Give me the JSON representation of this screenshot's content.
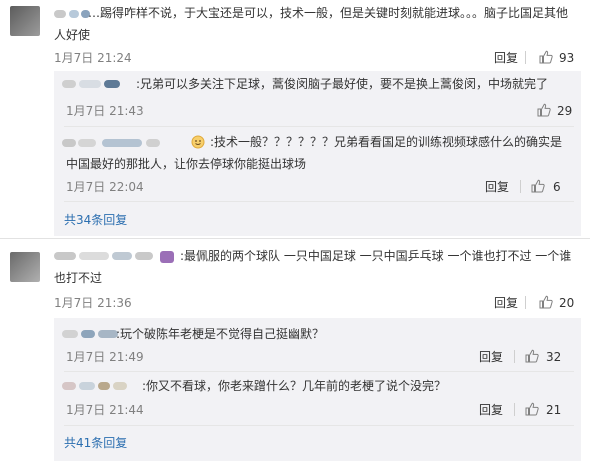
{
  "comments": [
    {
      "text": "…踢得咋样不说，于大宝还是可以，技术一般，但是关键时刻就能进球。。。脑子比国足其他人好使",
      "time": "1月7日 21:24",
      "reply_label": "回复",
      "likes": "93",
      "replies": [
        {
          "text": ":兄弟可以多关注下足球，蒿俊闵脑子最好使，要不是换上蒿俊闵，中场就完了",
          "time": "1月7日 21:43",
          "likes": "29"
        },
        {
          "text": ":技术一般？？？？？？兄弟看看国足的训练视频球感什么的确实是中国最好的那批人，让你去停球你能挺出球场",
          "time": "1月7日 22:04",
          "likes": "6",
          "reply_label": "回复"
        }
      ],
      "more_label": "共34条回复"
    },
    {
      "text": ":最佩服的两个球队  一只中国足球 一只中国乒乓球  一个谁也打不过 一个谁也打不过",
      "time": "1月7日 21:36",
      "reply_label": "回复",
      "likes": "20",
      "replies": [
        {
          "text": ":玩个破陈年老梗是不觉得自己挺幽默？",
          "time": "1月7日 21:49",
          "likes": "32",
          "reply_label": "回复"
        },
        {
          "text": ":你又不看球，你老来蹭什么？几年前的老梗了说个没完？",
          "time": "1月7日 21:44",
          "likes": "21",
          "reply_label": "回复"
        }
      ],
      "more_label": "共41条回复"
    }
  ]
}
